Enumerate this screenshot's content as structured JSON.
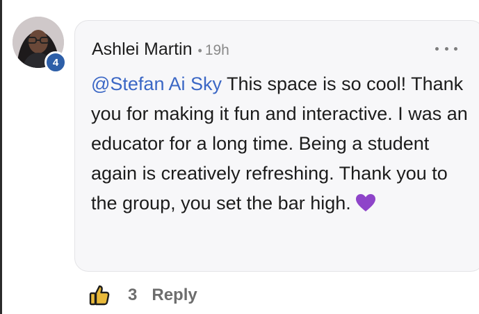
{
  "comment": {
    "author": "Ashlei Martin",
    "separator": "•",
    "time": "19h",
    "badge_count": "4",
    "mention": "@Stefan Ai Sky",
    "text": " This space is so cool! Thank you for making it fun and interactive. I was an educator for a long time. Being a student again is creatively refreshing. Thank you to the group, you set the bar high.",
    "emoji": "purple-heart",
    "like_count": "3",
    "reply_label": "Reply"
  },
  "icons": {
    "avatar": "avatar-photo",
    "more": "more-options-icon",
    "like": "thumbs-up-icon",
    "heart": "purple-heart-icon"
  },
  "colors": {
    "mention": "#3b67c5",
    "badge": "#2e5fa8",
    "bubble_background": "#f7f7f9",
    "heart": "#8e44c9",
    "meta_text": "#8a8a8a",
    "action_text": "#6d6d6d"
  }
}
